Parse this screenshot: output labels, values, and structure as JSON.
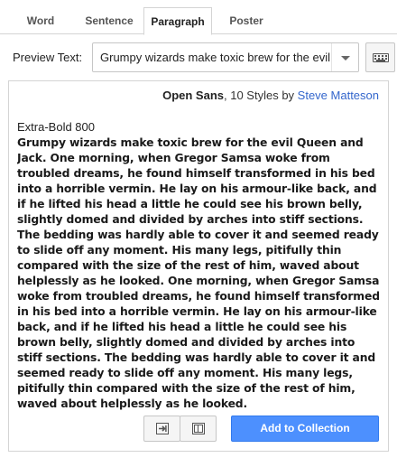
{
  "tabs": [
    {
      "label": "Word"
    },
    {
      "label": "Sentence"
    },
    {
      "label": "Paragraph"
    },
    {
      "label": "Poster"
    }
  ],
  "active_tab": "Paragraph",
  "preview": {
    "label": "Preview Text:",
    "value": "Grumpy wizards make toxic brew for the evil Queen and Jack."
  },
  "font": {
    "family": "Open Sans",
    "styles_text": ", 10 Styles by ",
    "designer": "Steve Matteson",
    "style_name": "Extra-Bold 800",
    "paragraph": "Grumpy wizards make toxic brew for the evil Queen and Jack. One morning, when Gregor Samsa woke from troubled dreams, he found himself transformed in his bed into a horrible vermin. He lay on his armour-like back, and if he lifted his head a little he could see his brown belly, slightly domed and divided by arches into stiff sections. The bedding was hardly able to cover it and seemed ready to slide off any moment. His many legs, pitifully thin compared with the size of the rest of him, waved about helplessly as he looked. One morning, when Gregor Samsa woke from troubled dreams, he found himself transformed in his bed into a horrible vermin. He lay on his armour-like back, and if he lifted his head a little he could see his brown belly, slightly domed and divided by arches into stiff sections. The bedding was hardly able to cover it and seemed ready to slide off any moment. His many legs, pitifully thin compared with the size of the rest of him, waved about helplessly as he looked."
  },
  "actions": {
    "add_label": "Add to Collection",
    "icons": [
      "open-in-icon",
      "compare-icon",
      "keyboard-icon",
      "chevron-down-icon"
    ]
  },
  "colors": {
    "accent": "#4d90fe",
    "link": "#3366cc",
    "border": "#d4d4d4"
  }
}
